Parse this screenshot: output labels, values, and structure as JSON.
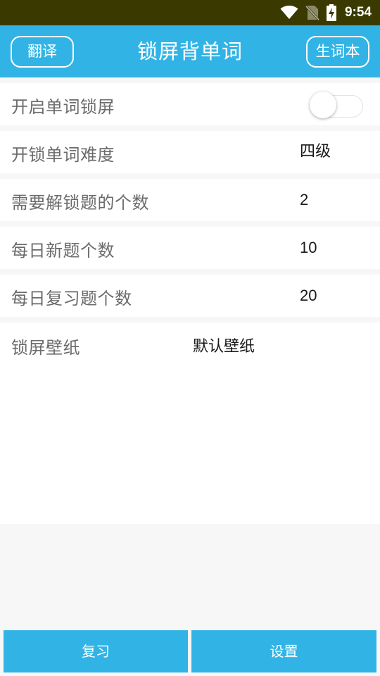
{
  "status_bar": {
    "time": "9:54",
    "icons": [
      "wifi-icon",
      "no-sim-icon",
      "battery-charging-icon"
    ],
    "background_color": "#3a3a00"
  },
  "app_bar": {
    "title": "锁屏背单词",
    "left_button": "翻译",
    "right_button": "生词本",
    "background_color": "#31b4e5"
  },
  "settings": {
    "enable_lock": {
      "label": "开启单词锁屏",
      "enabled": false
    },
    "difficulty": {
      "label": "开锁单词难度",
      "value": "四级"
    },
    "unlock_count": {
      "label": "需要解锁题的个数",
      "value": "2"
    },
    "daily_new": {
      "label": "每日新题个数",
      "value": "10"
    },
    "daily_review": {
      "label": "每日复习题个数",
      "value": "20"
    },
    "wallpaper": {
      "label": "锁屏壁纸",
      "value": "默认壁纸"
    }
  },
  "bottom_nav": {
    "review": "复习",
    "settings": "设置"
  }
}
